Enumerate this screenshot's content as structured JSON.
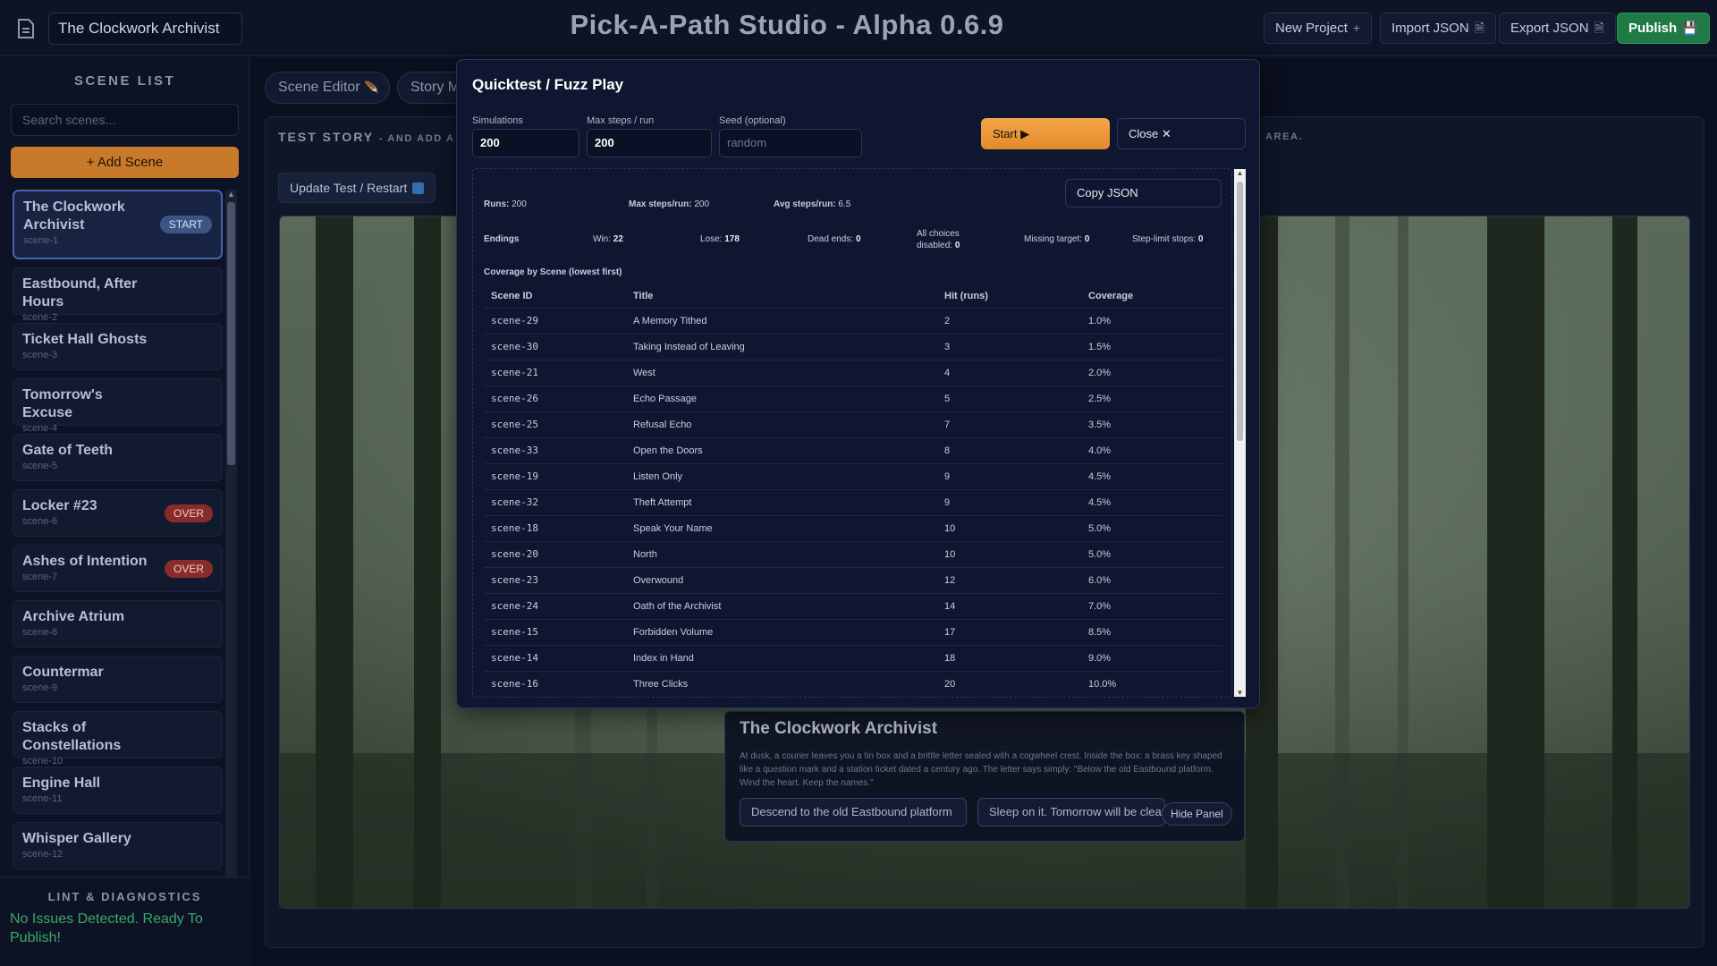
{
  "topbar": {
    "project_name": "The Clockwork Archivist",
    "app_title": "Pick-A-Path Studio - Alpha 0.6.9",
    "buttons": [
      {
        "label": "New Project",
        "icon": "+"
      },
      {
        "label": "Import JSON",
        "icon": "🗎"
      },
      {
        "label": "Export JSON",
        "icon": "🗎"
      },
      {
        "label": "Publish",
        "icon": "💾"
      }
    ]
  },
  "sidebar": {
    "title": "SCENE LIST",
    "search_placeholder": "Search scenes...",
    "add_scene_label": "+ Add Scene",
    "scenes": [
      {
        "title": "The Clockwork Archivist",
        "id": "scene-1",
        "badge": "START"
      },
      {
        "title": "Eastbound, After Hours",
        "id": "scene-2",
        "badge": ""
      },
      {
        "title": "Ticket Hall Ghosts",
        "id": "scene-3",
        "badge": ""
      },
      {
        "title": "Tomorrow's Excuse",
        "id": "scene-4",
        "badge": ""
      },
      {
        "title": "Gate of Teeth",
        "id": "scene-5",
        "badge": ""
      },
      {
        "title": "Locker #23",
        "id": "scene-6",
        "badge": "OVER"
      },
      {
        "title": "Ashes of Intention",
        "id": "scene-7",
        "badge": "OVER"
      },
      {
        "title": "Archive Atrium",
        "id": "scene-8",
        "badge": ""
      },
      {
        "title": "Countermar",
        "id": "scene-9",
        "badge": ""
      },
      {
        "title": "Stacks of Constellations",
        "id": "scene-10",
        "badge": ""
      },
      {
        "title": "Engine Hall",
        "id": "scene-11",
        "badge": ""
      },
      {
        "title": "Whisper Gallery",
        "id": "scene-12",
        "badge": ""
      }
    ],
    "lint_title": "LINT & DIAGNOSTICS",
    "lint_message": "No Issues Detected. Ready To Publish!"
  },
  "main": {
    "tabs": [
      "Scene Editor",
      "Story M"
    ],
    "tab_icon": "🪶",
    "panel_title": "TEST STORY",
    "panel_subtitle": "- AND ADD A E",
    "panel_subtitle_end": "AREA.",
    "update_button": "Update Test / Restart",
    "scene_card": {
      "title": "The Clockwork Archivist",
      "text": "At dusk, a courier leaves you a tin box and a brittle letter sealed with a cogwheel crest. Inside the box: a brass key shaped like a question mark and a station ticket dated a century ago. The letter says simply: \"Below the old Eastbound platform. Wind the heart. Keep the names.\"",
      "choices": [
        "Descend to the old Eastbound platform",
        "Sleep on it. Tomorrow will be clear"
      ],
      "hide_panel": "Hide Panel"
    }
  },
  "modal": {
    "title": "Quicktest / Fuzz Play",
    "fields": [
      {
        "label": "Simulations",
        "value": "200",
        "placeholder": ""
      },
      {
        "label": "Max steps / run",
        "value": "200",
        "placeholder": ""
      },
      {
        "label": "Seed (optional)",
        "value": "",
        "placeholder": "random"
      }
    ],
    "start_label": "Start ▶",
    "close_label": "Close ✕",
    "copy_json_label": "Copy JSON",
    "summary": {
      "runs_label": "Runs:",
      "runs": "200",
      "max_steps_label": "Max steps/run:",
      "max_steps": "200",
      "avg_steps_label": "Avg steps/run:",
      "avg_steps": "6.5"
    },
    "endings": {
      "label": "Endings",
      "win_label": "Win:",
      "win": "22",
      "lose_label": "Lose:",
      "lose": "178",
      "dead_ends_label": "Dead ends:",
      "dead_ends": "0",
      "all_disabled_label": "All choices disabled:",
      "all_disabled": "0",
      "missing_target_label": "Missing target:",
      "missing_target": "0",
      "step_limit_label": "Step-limit stops:",
      "step_limit": "0"
    },
    "coverage_title": "Coverage by Scene (lowest first)",
    "columns": [
      "Scene ID",
      "Title",
      "Hit (runs)",
      "Coverage"
    ],
    "rows": [
      [
        "scene-29",
        "A Memory Tithed",
        "2",
        "1.0%"
      ],
      [
        "scene-30",
        "Taking Instead of Leaving",
        "3",
        "1.5%"
      ],
      [
        "scene-21",
        "West",
        "4",
        "2.0%"
      ],
      [
        "scene-26",
        "Echo Passage",
        "5",
        "2.5%"
      ],
      [
        "scene-25",
        "Refusal Echo",
        "7",
        "3.5%"
      ],
      [
        "scene-33",
        "Open the Doors",
        "8",
        "4.0%"
      ],
      [
        "scene-19",
        "Listen Only",
        "9",
        "4.5%"
      ],
      [
        "scene-32",
        "Theft Attempt",
        "9",
        "4.5%"
      ],
      [
        "scene-18",
        "Speak Your Name",
        "10",
        "5.0%"
      ],
      [
        "scene-20",
        "North",
        "10",
        "5.0%"
      ],
      [
        "scene-23",
        "Overwound",
        "12",
        "6.0%"
      ],
      [
        "scene-24",
        "Oath of the Archivist",
        "14",
        "7.0%"
      ],
      [
        "scene-15",
        "Forbidden Volume",
        "17",
        "8.5%"
      ],
      [
        "scene-14",
        "Index in Hand",
        "18",
        "9.0%"
      ],
      [
        "scene-16",
        "Three Clicks",
        "20",
        "10.0%"
      ]
    ]
  }
}
